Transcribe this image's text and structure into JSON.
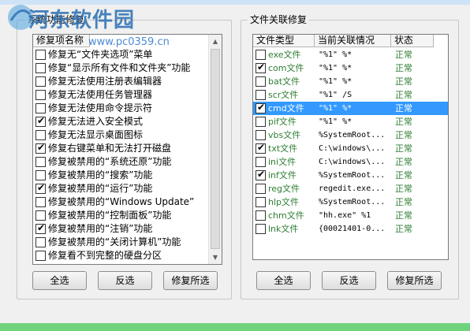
{
  "left_panel": {
    "title": "系统功能修复",
    "column_header": "修复项名称",
    "items": [
      {
        "label": "修复无“文件夹选项”菜单",
        "checked": false
      },
      {
        "label": "修复“显示所有文件和文件夹”功能",
        "checked": false
      },
      {
        "label": "修复无法使用注册表编辑器",
        "checked": false
      },
      {
        "label": "修复无法使用任务管理器",
        "checked": false
      },
      {
        "label": "修复无法使用命令提示符",
        "checked": false
      },
      {
        "label": "修复无法进入安全模式",
        "checked": true
      },
      {
        "label": "修复无法显示桌面图标",
        "checked": false
      },
      {
        "label": "修复右键菜单和无法打开磁盘",
        "checked": true
      },
      {
        "label": "修复被禁用的“系统还原”功能",
        "checked": false
      },
      {
        "label": "修复被禁用的“搜索”功能",
        "checked": false
      },
      {
        "label": "修复被禁用的“运行”功能",
        "checked": true
      },
      {
        "label": "修复被禁用的“Windows Update”",
        "checked": false
      },
      {
        "label": "修复被禁用的“控制面板”功能",
        "checked": false
      },
      {
        "label": "修复被禁用的“注销”功能",
        "checked": true
      },
      {
        "label": "修复被禁用的“关闭计算机”功能",
        "checked": false
      },
      {
        "label": "修复看不到完整的硬盘分区",
        "checked": false
      }
    ],
    "buttons": {
      "select_all": "全选",
      "invert": "反选",
      "repair": "修复所选"
    }
  },
  "right_panel": {
    "title": "文件关联修复",
    "columns": {
      "type": "文件类型",
      "assoc": "当前关联情况",
      "status": "状态"
    },
    "rows": [
      {
        "type": "exe文件",
        "assoc": "\"%1\" %*",
        "status": "正常",
        "checked": false
      },
      {
        "type": "com文件",
        "assoc": "\"%1\" %*",
        "status": "正常",
        "checked": true
      },
      {
        "type": "bat文件",
        "assoc": "\"%1\" %*",
        "status": "正常",
        "checked": false
      },
      {
        "type": "scr文件",
        "assoc": "\"%1\" /S",
        "status": "正常",
        "checked": false
      },
      {
        "type": "cmd文件",
        "assoc": "\"%1\" %*",
        "status": "正常",
        "checked": true
      },
      {
        "type": "pif文件",
        "assoc": "\"%1\" %*",
        "status": "正常",
        "checked": false
      },
      {
        "type": "vbs文件",
        "assoc": "%SystemRoot...",
        "status": "正常",
        "checked": false
      },
      {
        "type": "txt文件",
        "assoc": "C:\\windows\\...",
        "status": "正常",
        "checked": true
      },
      {
        "type": "ini文件",
        "assoc": "C:\\windows\\...",
        "status": "正常",
        "checked": false
      },
      {
        "type": "inf文件",
        "assoc": "%SystemRoot...",
        "status": "正常",
        "checked": true
      },
      {
        "type": "reg文件",
        "assoc": "regedit.exe...",
        "status": "正常",
        "checked": false
      },
      {
        "type": "hlp文件",
        "assoc": "%SystemRoot...",
        "status": "正常",
        "checked": false
      },
      {
        "type": "chm文件",
        "assoc": "\"hh.exe\" %1",
        "status": "正常",
        "checked": false
      },
      {
        "type": "lnk文件",
        "assoc": "{00021401-0...",
        "status": "正常",
        "checked": false
      }
    ],
    "selected_row": "cmd文件",
    "buttons": {
      "select_all": "全选",
      "invert": "反选",
      "repair": "修复所选"
    }
  },
  "watermark": {
    "name": "河东软件园",
    "url": "www.pc0359.cn"
  },
  "colors": {
    "selection": "#3399ff",
    "file_type_text": "#2e7d32",
    "window_bottom": "#6fd37e"
  }
}
